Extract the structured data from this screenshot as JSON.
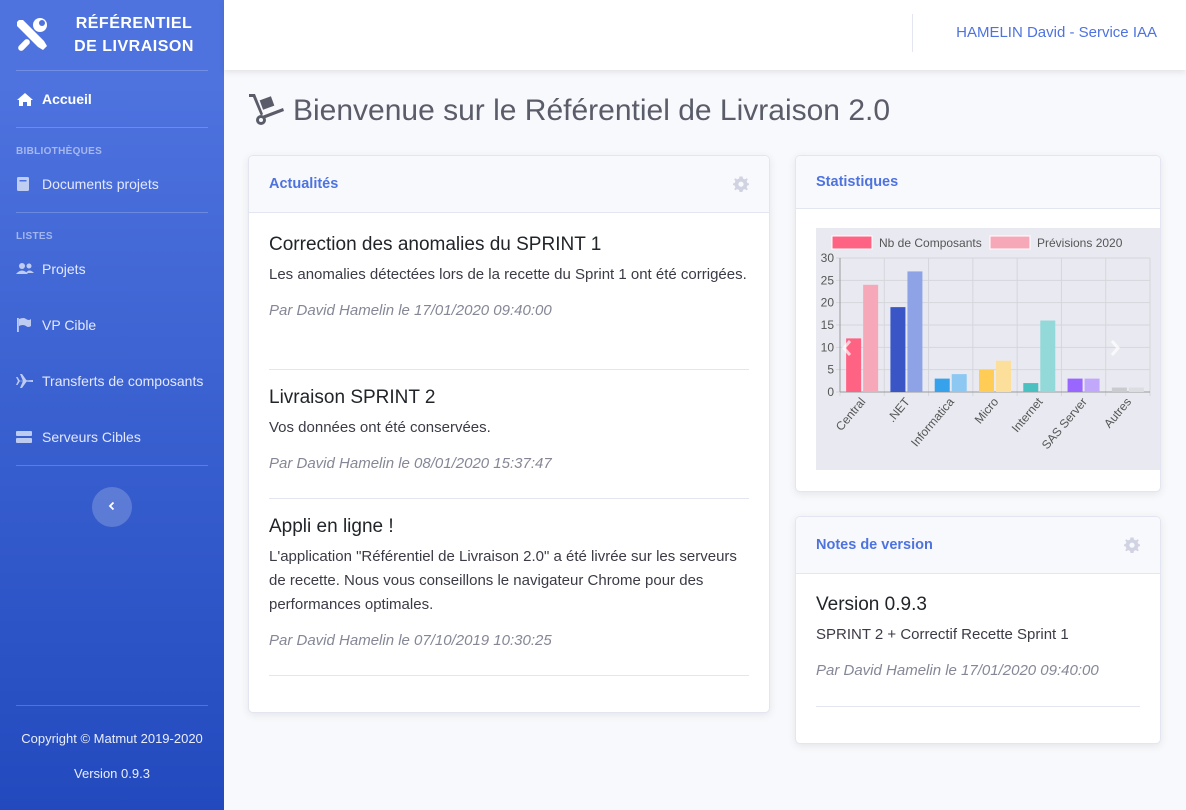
{
  "sidebar": {
    "brand_line1": "RÉFÉRENTIEL",
    "brand_line2": "DE LIVRAISON",
    "home": "Accueil",
    "heading_libraries": "BIBLIOTHÈQUES",
    "documents": "Documents projets",
    "heading_lists": "LISTES",
    "projects": "Projets",
    "vp_target": "VP Cible",
    "transfers": "Transferts de composants",
    "servers": "Serveurs Cibles",
    "copyright": "Copyright © Matmut 2019-2020",
    "version": "Version 0.9.3"
  },
  "topbar": {
    "user": "HAMELIN David - Service IAA"
  },
  "page": {
    "title": "Bienvenue sur le Référentiel de Livraison 2.0"
  },
  "news": {
    "title": "Actualités",
    "items": [
      {
        "title": "Correction des anomalies du SPRINT 1",
        "body": "Les anomalies détectées lors de la recette du Sprint 1 ont été corrigées.",
        "by": "Par David Hamelin le 17/01/2020 09:40:00"
      },
      {
        "title": "Livraison SPRINT 2",
        "body": "Vos données ont été conservées.",
        "by": "Par David Hamelin le 08/01/2020 15:37:47"
      },
      {
        "title": "Appli en ligne !",
        "body": "L'application \"Référentiel de Livraison 2.0\" a été livrée sur les serveurs de recette. Nous vous conseillons le navigateur Chrome pour des performances optimales.",
        "by": "Par David Hamelin le 07/10/2019 10:30:25"
      }
    ]
  },
  "stats": {
    "title": "Statistiques"
  },
  "release_notes": {
    "title": "Notes de version",
    "version": "Version 0.9.3",
    "body": "SPRINT 2 + Correctif Recette Sprint 1",
    "by": "Par David Hamelin le 17/01/2020 09:40:00"
  },
  "chart_data": {
    "type": "bar",
    "categories": [
      "Central",
      ".NET",
      "Informatica",
      "Micro",
      "Internet",
      "SAS Server",
      "Autres"
    ],
    "series": [
      {
        "name": "Nb de Composants",
        "values": [
          12,
          19,
          3,
          5,
          2,
          3,
          1
        ],
        "colors": [
          "#ff6384",
          "#3a55c6",
          "#36a2eb",
          "#ffcd56",
          "#4bc0c0",
          "#9966ff",
          "#c9cbcf"
        ]
      },
      {
        "name": "Prévisions 2020",
        "values": [
          24,
          27,
          4,
          7,
          16,
          3,
          1
        ],
        "colors": [
          "#f7a8b8",
          "#8ea3e6",
          "#8cc8f2",
          "#fbdf9b",
          "#93d9d9",
          "#c2a8fb",
          "#dcdde0"
        ]
      }
    ],
    "legend_colors": [
      "#ff6384",
      "#f7a8b8"
    ],
    "ylim": [
      0,
      30
    ],
    "yticks": [
      0,
      5,
      10,
      15,
      20,
      25,
      30
    ],
    "grid": true,
    "legend": "top"
  }
}
